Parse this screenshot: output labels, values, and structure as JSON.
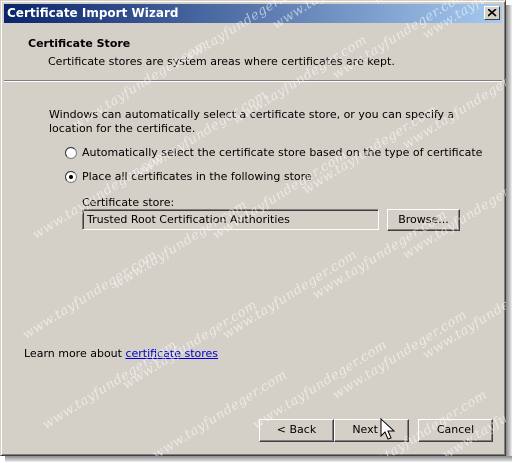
{
  "window": {
    "title": "Certificate Import Wizard",
    "close_symbol": "×"
  },
  "header": {
    "title": "Certificate Store",
    "subtitle": "Certificate stores are system areas where certificates are kept."
  },
  "body": {
    "intro": "Windows can automatically select a certificate store, or you can specify a location for the certificate.",
    "options": [
      {
        "label": "Automatically select the certificate store based on the type of certificate",
        "selected": false
      },
      {
        "label": "Place all certificates in the following store",
        "selected": true
      }
    ],
    "store_label": "Certificate store:",
    "store_value": "Trusted Root Certification Authorities",
    "browse_label": "Browse..."
  },
  "footer": {
    "learn_more_prefix": "Learn more about ",
    "learn_more_link": "certificate stores",
    "back_label": "< Back",
    "next_label": "Next >",
    "cancel_label": "Cancel"
  },
  "watermark_text": "www.tayfundeger.com",
  "colors": {
    "face": "#d4d0c8",
    "title_start": "#0a246a",
    "title_end": "#a6caf0",
    "link": "#0000cc"
  }
}
